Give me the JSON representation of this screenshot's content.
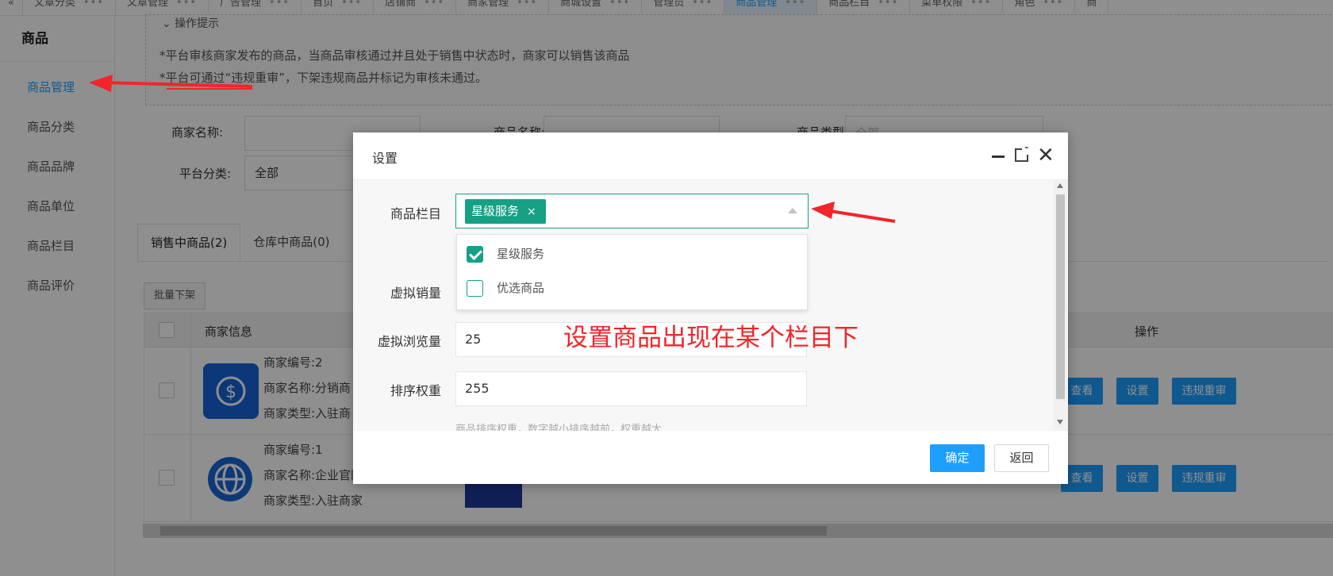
{
  "top_tabs": [
    {
      "label": "文章分类"
    },
    {
      "label": "文章管理"
    },
    {
      "label": "广告管理"
    },
    {
      "label": "首页"
    },
    {
      "label": "店铺商"
    },
    {
      "label": "商家管理"
    },
    {
      "label": "商城设置"
    },
    {
      "label": "管理员"
    },
    {
      "label": "商品管理",
      "active": true
    },
    {
      "label": "商品栏目"
    },
    {
      "label": "菜单权限"
    },
    {
      "label": "角色"
    },
    {
      "label": "商"
    }
  ],
  "tab_dots": "•••",
  "sidebar": {
    "title": "商品",
    "items": [
      {
        "label": "商品管理",
        "active": true
      },
      {
        "label": "商品分类"
      },
      {
        "label": "商品品牌"
      },
      {
        "label": "商品单位"
      },
      {
        "label": "商品栏目"
      },
      {
        "label": "商品评价"
      }
    ]
  },
  "tips": {
    "header": "操作提示",
    "lines": [
      "*平台审核商家发布的商品，当商品审核通过并且处于销售中状态时，商家可以销售该商品",
      "*平台可通过“违规重审”，下架违规商品并标记为审核未通过。"
    ]
  },
  "filters": {
    "merchant_name_label": "商家名称:",
    "goods_name_label": "商品名称:",
    "goods_type_label": "商品类型:",
    "goods_type_value": "全部",
    "platform_category_label": "平台分类:",
    "platform_category_value": "全部"
  },
  "content_tabs": [
    {
      "label": "销售中商品(2)",
      "active": true
    },
    {
      "label": "仓库中商品(0)"
    }
  ],
  "batch_button": "批量下架",
  "table": {
    "col_merchant": "商家信息",
    "col_ops": "操作",
    "rows": [
      {
        "merchant_no": "商家编号:2",
        "merchant_name": "商家名称:分销商",
        "merchant_type": "商家类型:入驻商"
      },
      {
        "merchant_no": "商家编号:1",
        "merchant_name": "商家名称:企业官网",
        "merchant_type": "商家类型:入驻商家"
      }
    ],
    "op_view": "查看",
    "op_set": "设置",
    "op_recheck": "违规重审"
  },
  "modal": {
    "title": "设置",
    "column_label": "商品栏目",
    "selected_chip": "星级服务",
    "chip_remove": "×",
    "options": [
      {
        "label": "星级服务",
        "checked": true
      },
      {
        "label": "优选商品",
        "checked": false
      }
    ],
    "virtual_sales_label": "虚拟销量",
    "virtual_views_label": "虚拟浏览量",
    "virtual_views_value": "25",
    "sort_weight_label": "排序权重",
    "sort_weight_value": "255",
    "hint": "商品排序权重，数字越小排序越前，权重越大",
    "confirm": "确定",
    "back": "返回"
  },
  "annotation": "设置商品出现在某个栏目下",
  "colors": {
    "primary": "#1e9fff",
    "select_accent": "#16a085",
    "annotation_red": "#f0262b"
  }
}
